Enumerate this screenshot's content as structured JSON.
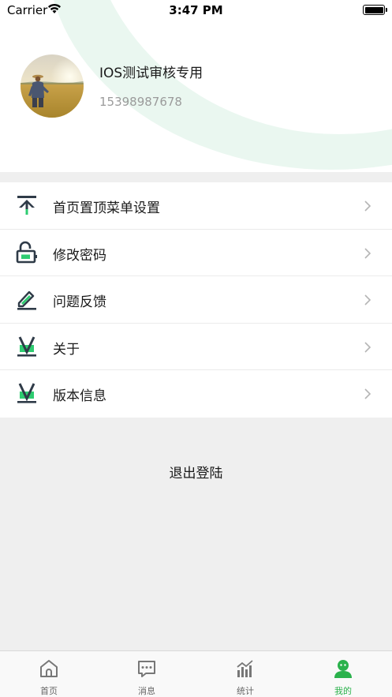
{
  "status_bar": {
    "carrier": "Carrier",
    "time": "3:47 PM"
  },
  "profile": {
    "name": "IOS测试审核专用",
    "phone": "15398987678"
  },
  "menu": {
    "items": [
      {
        "label": "首页置顶菜单设置",
        "icon": "pin-top-icon"
      },
      {
        "label": "修改密码",
        "icon": "unlock-icon"
      },
      {
        "label": "问题反馈",
        "icon": "edit-feedback-icon"
      },
      {
        "label": "关于",
        "icon": "about-v-icon"
      },
      {
        "label": "版本信息",
        "icon": "version-v-icon"
      }
    ]
  },
  "logout_label": "退出登陆",
  "tabbar": {
    "tabs": [
      {
        "label": "首页",
        "icon": "home-icon"
      },
      {
        "label": "消息",
        "icon": "message-icon"
      },
      {
        "label": "统计",
        "icon": "stats-icon"
      },
      {
        "label": "我的",
        "icon": "profile-icon"
      }
    ],
    "active_index": 3
  },
  "colors": {
    "accent": "#2bb24c",
    "icon_dark": "#2f3b48",
    "icon_green": "#2ecc71",
    "page_bg": "#efefef",
    "header_arc": "#eaf7f0"
  }
}
